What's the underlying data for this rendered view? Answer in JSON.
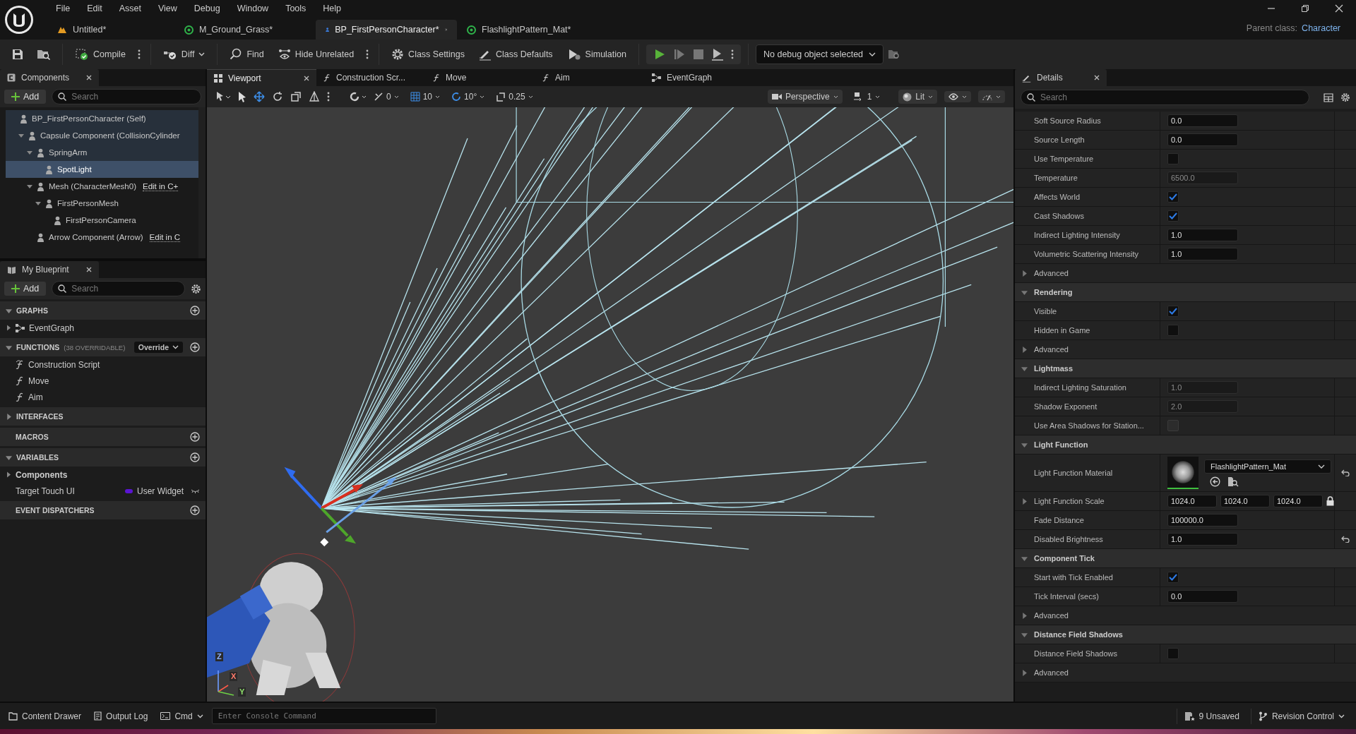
{
  "menu": [
    "File",
    "Edit",
    "Asset",
    "View",
    "Debug",
    "Window",
    "Tools",
    "Help"
  ],
  "document_tabs": [
    {
      "label": "Untitled*",
      "kind": "level",
      "selected": false
    },
    {
      "label": "M_Ground_Grass*",
      "kind": "material",
      "selected": false
    },
    {
      "label": "BP_FirstPersonCharacter*",
      "kind": "blueprint",
      "selected": true
    },
    {
      "label": "FlashlightPattern_Mat*",
      "kind": "material",
      "selected": false
    }
  ],
  "parent_class": {
    "label": "Parent class:",
    "value": "Character"
  },
  "toolbar": {
    "buttons": [
      {
        "label": "Compile",
        "kind": "compile",
        "more": true
      },
      {
        "label": "Diff",
        "kind": "diff",
        "caret": true
      },
      {
        "label": "Find",
        "kind": "find"
      },
      {
        "label": "Hide Unrelated",
        "kind": "hide",
        "more": true
      },
      {
        "label": "Class Settings",
        "kind": "settings"
      },
      {
        "label": "Class Defaults",
        "kind": "defaults"
      },
      {
        "label": "Simulation",
        "kind": "simulation"
      }
    ],
    "debug_object": "No debug object selected"
  },
  "components": {
    "title": "Components",
    "add": "Add",
    "search_placeholder": "Search",
    "tree": [
      {
        "label": "BP_FirstPersonCharacter (Self)",
        "selected": false,
        "children": [
          {
            "label": "Capsule Component (CollisionCylinder",
            "selected": false,
            "expanded": true,
            "children": [
              {
                "label": "SpringArm",
                "selected": false,
                "expanded": true,
                "children": [
                  {
                    "label": "SpotLight",
                    "selected": true
                  }
                ]
              },
              {
                "label": "Mesh (CharacterMesh0)",
                "link": "Edit in C+",
                "selected": false,
                "expanded": true,
                "children": [
                  {
                    "label": "FirstPersonMesh",
                    "selected": false,
                    "expanded": true,
                    "children": [
                      {
                        "label": "FirstPersonCamera",
                        "selected": false
                      }
                    ]
                  }
                ]
              },
              {
                "label": "Arrow Component (Arrow)",
                "link": "Edit in C",
                "selected": false
              }
            ]
          }
        ]
      }
    ]
  },
  "my_blueprint": {
    "title": "My Blueprint",
    "add": "Add",
    "search_placeholder": "Search",
    "sections": [
      {
        "title": "GRAPHS",
        "expanded": true,
        "add_button": true,
        "items": [
          {
            "label": "EventGraph",
            "kind": "graph"
          }
        ]
      },
      {
        "title": "FUNCTIONS",
        "note": "(38 OVERRIDABLE)",
        "override": "Override",
        "expanded": true,
        "add_button": true,
        "items": [
          {
            "label": "Construction Script",
            "kind": "construction"
          },
          {
            "label": "Move",
            "kind": "function"
          },
          {
            "label": "Aim",
            "kind": "function"
          }
        ]
      },
      {
        "title": "INTERFACES",
        "expanded": false,
        "add_button": false
      },
      {
        "title": "MACROS",
        "add_button": true
      },
      {
        "title": "VARIABLES",
        "expanded": true,
        "add_button": true,
        "items": [
          {
            "label": "Components",
            "kind": "category",
            "expanded": false
          },
          {
            "label": "Target Touch UI",
            "kind": "variable",
            "type": "User Widget",
            "color": "#5a14d2"
          }
        ]
      },
      {
        "title": "EVENT DISPATCHERS",
        "add_button": true
      }
    ]
  },
  "editor_tabs": [
    {
      "label": "Viewport",
      "kind": "viewport",
      "selected": true
    },
    {
      "label": "Construction Scr...",
      "kind": "function",
      "selected": false
    },
    {
      "label": "Move",
      "kind": "function",
      "selected": false
    },
    {
      "label": "Aim",
      "kind": "function",
      "selected": false
    },
    {
      "label": "EventGraph",
      "kind": "graph",
      "selected": false
    }
  ],
  "viewport": {
    "snaps": [
      "0",
      "10",
      "10°",
      "0.25"
    ],
    "view_mode": "Perspective",
    "camera_speed": "1",
    "lighting": "Lit",
    "axis_labels": [
      "Z",
      "X",
      "Y"
    ]
  },
  "details": {
    "title": "Details",
    "search_placeholder": "Search",
    "rows": [
      {
        "kind": "number",
        "label": "Soft Source Radius",
        "value": "0.0",
        "disabled": false
      },
      {
        "kind": "number",
        "label": "Source Length",
        "value": "0.0",
        "disabled": false
      },
      {
        "kind": "checkbox",
        "label": "Use Temperature",
        "checked": false,
        "disabled": false
      },
      {
        "kind": "number",
        "label": "Temperature",
        "value": "6500.0",
        "disabled": true
      },
      {
        "kind": "checkbox",
        "label": "Affects World",
        "checked": true,
        "disabled": false
      },
      {
        "kind": "checkbox",
        "label": "Cast Shadows",
        "checked": true,
        "disabled": false
      },
      {
        "kind": "number",
        "label": "Indirect Lighting Intensity",
        "value": "1.0",
        "disabled": false
      },
      {
        "kind": "number",
        "label": "Volumetric Scattering Intensity",
        "value": "1.0",
        "disabled": false
      },
      {
        "kind": "group",
        "label": "Advanced",
        "expanded": false
      },
      {
        "kind": "section",
        "label": "Rendering",
        "expanded": true
      },
      {
        "kind": "checkbox",
        "label": "Visible",
        "checked": true,
        "disabled": false
      },
      {
        "kind": "checkbox",
        "label": "Hidden in Game",
        "checked": false,
        "disabled": false
      },
      {
        "kind": "group",
        "label": "Advanced",
        "expanded": false
      },
      {
        "kind": "section",
        "label": "Lightmass",
        "expanded": true
      },
      {
        "kind": "number",
        "label": "Indirect Lighting Saturation",
        "value": "1.0",
        "disabled": true
      },
      {
        "kind": "number",
        "label": "Shadow Exponent",
        "value": "2.0",
        "disabled": true
      },
      {
        "kind": "checkbox",
        "label": "Use Area Shadows for Station...",
        "checked": false,
        "disabled": true
      },
      {
        "kind": "section",
        "label": "Light Function",
        "expanded": true
      },
      {
        "kind": "material",
        "label": "Light Function Material",
        "value": "FlashlightPattern_Mat",
        "reset": true
      },
      {
        "kind": "vector",
        "label": "Light Function Scale",
        "values": [
          "1024.0",
          "1024.0",
          "1024.0"
        ],
        "expanded": false,
        "locked": true
      },
      {
        "kind": "number",
        "label": "Fade Distance",
        "value": "100000.0",
        "disabled": false
      },
      {
        "kind": "number",
        "label": "Disabled Brightness",
        "value": "1.0",
        "disabled": false,
        "reset": true
      },
      {
        "kind": "section",
        "label": "Component Tick",
        "expanded": true
      },
      {
        "kind": "checkbox",
        "label": "Start with Tick Enabled",
        "checked": true,
        "disabled": false
      },
      {
        "kind": "number",
        "label": "Tick Interval (secs)",
        "value": "0.0",
        "disabled": false
      },
      {
        "kind": "group",
        "label": "Advanced",
        "expanded": false
      },
      {
        "kind": "section",
        "label": "Distance Field Shadows",
        "expanded": true
      },
      {
        "kind": "checkbox",
        "label": "Distance Field Shadows",
        "checked": false,
        "disabled": false
      },
      {
        "kind": "group",
        "label": "Advanced",
        "expanded": false
      }
    ]
  },
  "status_bar": {
    "content_drawer": "Content Drawer",
    "output_log": "Output Log",
    "cmd": "Cmd",
    "console_placeholder": "Enter Console Command",
    "unsaved": "9 Unsaved",
    "revision_control": "Revision Control"
  }
}
